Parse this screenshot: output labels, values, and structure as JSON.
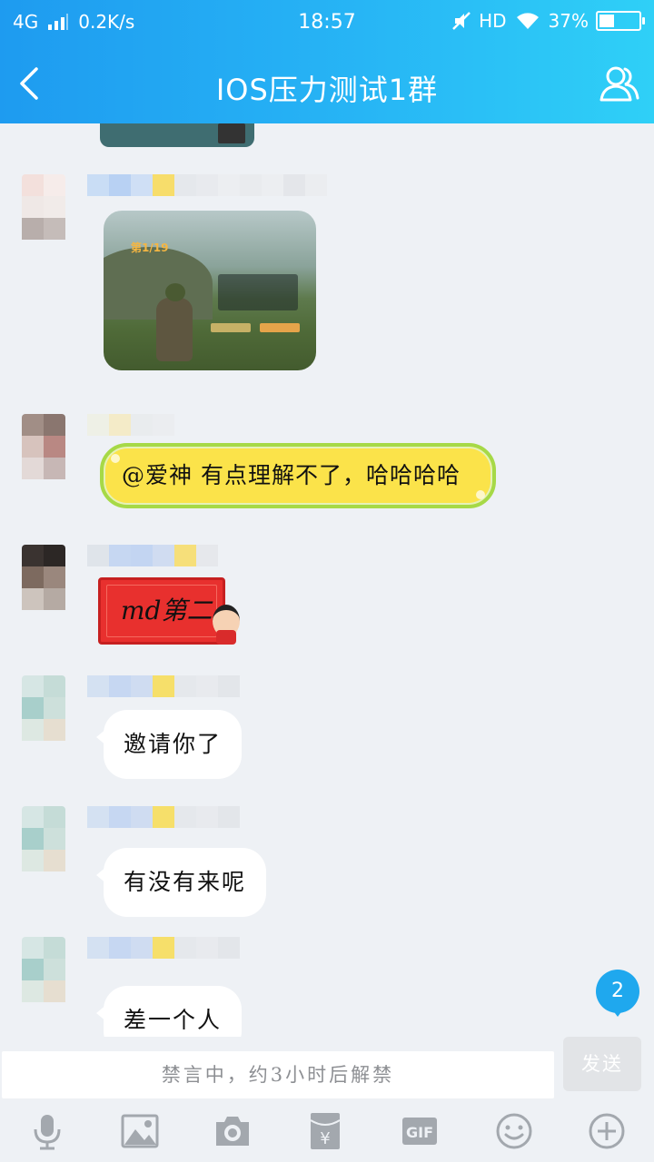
{
  "status": {
    "network": "4G",
    "speed": "0.2K/s",
    "time": "18:57",
    "hd": "HD",
    "battery": "37%",
    "battery_level": 0.37
  },
  "header": {
    "title": "IOS压力测试1群"
  },
  "messages": {
    "m1_text": "@爱神 有点理解不了，哈哈哈哈",
    "m2_sticker": "md第二",
    "m3_text": "邀请你了",
    "m4_text": "有没有来呢",
    "m5_text": "差一个人"
  },
  "game_image": {
    "rank": "第1/19"
  },
  "unread_badge": "2",
  "input": {
    "muted_notice": "禁言中，约3小时后解禁",
    "send_label": "发送"
  },
  "toolbar": {
    "gif_label": "GIF"
  },
  "colors": {
    "header_start": "#1e9bf0",
    "header_end": "#2fd0f7",
    "badge": "#1fa8ee",
    "yellow_bubble": "#fbe34a"
  },
  "icons": [
    "back-icon",
    "members-icon",
    "microphone-icon",
    "image-icon",
    "camera-icon",
    "red-packet-icon",
    "gif-icon",
    "emoji-icon",
    "plus-icon"
  ]
}
